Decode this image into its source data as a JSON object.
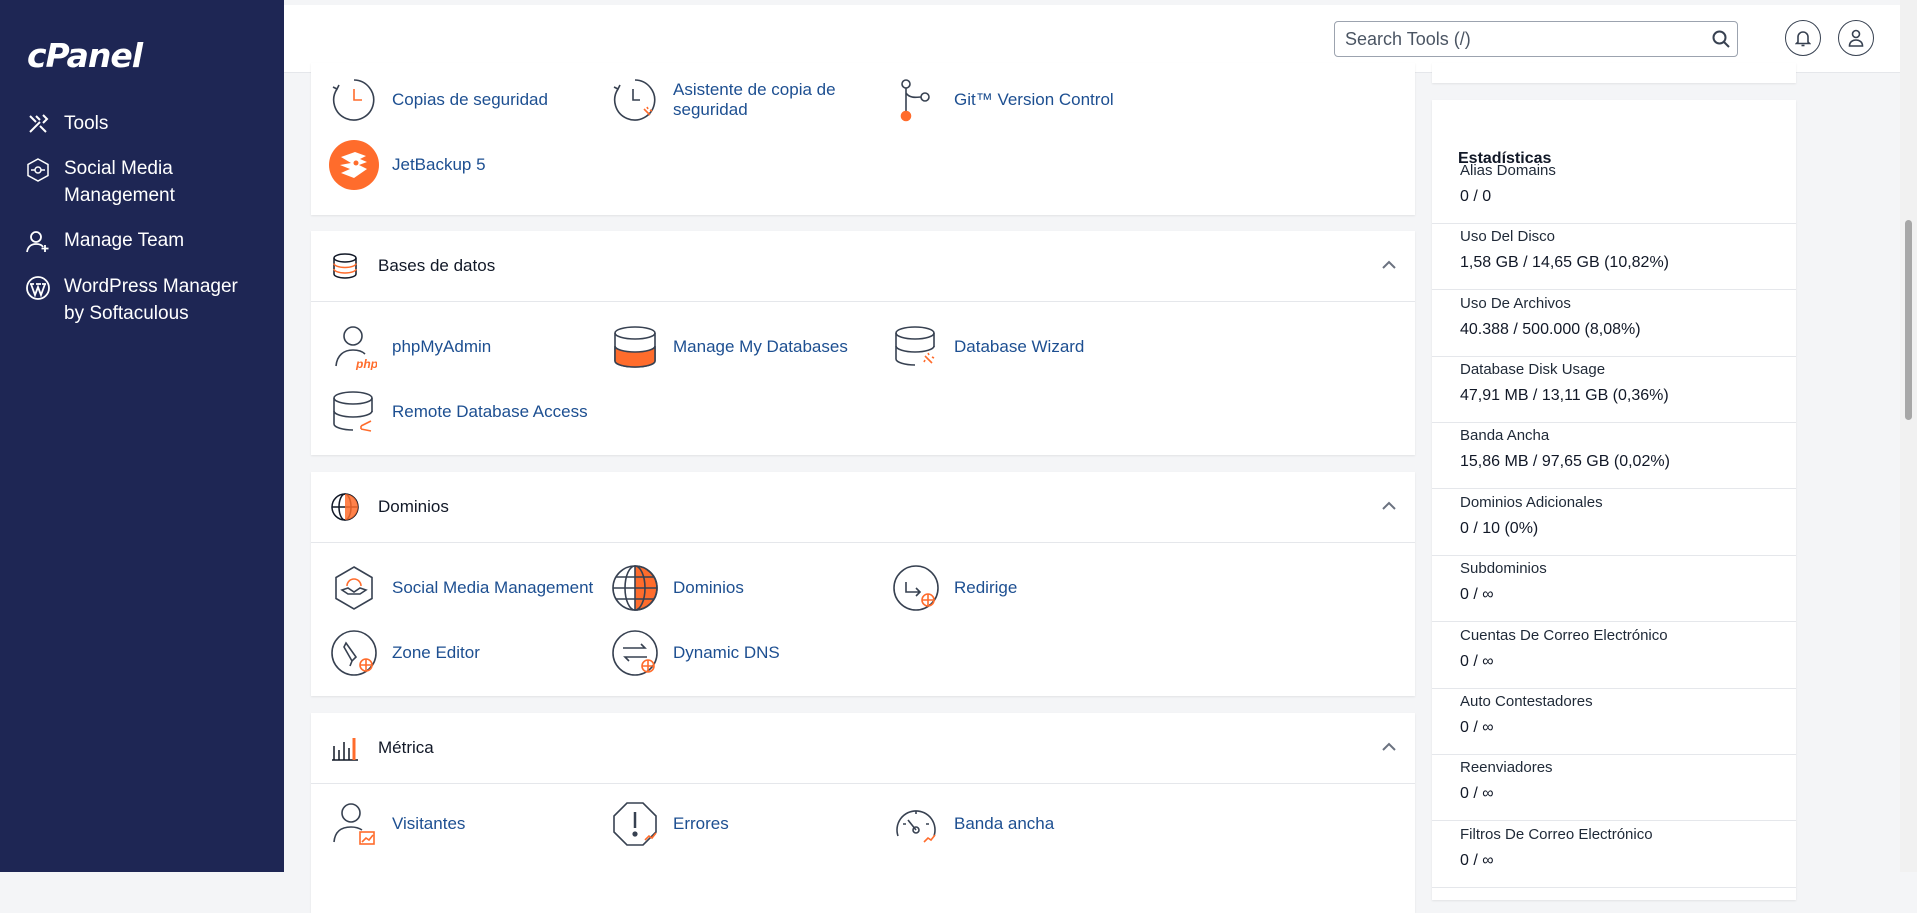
{
  "sidebar": {
    "logo": "cPanel",
    "items": [
      {
        "label_line1": "Tools",
        "label_line2": "",
        "icon": "tools-icon"
      },
      {
        "label_line1": "Social Media",
        "label_line2": "Management",
        "icon": "social-media-icon"
      },
      {
        "label_line1": "Manage Team",
        "label_line2": "",
        "icon": "manage-team-icon"
      },
      {
        "label_line1": "WordPress Manager",
        "label_line2": "by Softaculous",
        "icon": "wordpress-icon"
      }
    ]
  },
  "header": {
    "search_placeholder": "Search Tools (/)"
  },
  "sections": {
    "files": {
      "tools": [
        "Copias de seguridad",
        "Asistente de copia de",
        "seguridad",
        "Git™ Version Control",
        "JetBackup 5"
      ]
    },
    "databases": {
      "title": "Bases de datos",
      "tools": [
        "phpMyAdmin",
        "Manage My Databases",
        "Database Wizard",
        "Remote Database Access"
      ]
    },
    "domains": {
      "title": "Dominios",
      "tools": [
        "Social Media Management",
        "Dominios",
        "Redirige",
        "Zone Editor",
        "Dynamic DNS"
      ]
    },
    "metrics": {
      "title": "Métrica",
      "tools": [
        "Visitantes",
        "Errores",
        "Banda ancha"
      ]
    }
  },
  "stats": {
    "title": "Estadísticas",
    "items": [
      {
        "label": "Alias Domains",
        "value": "0 / 0"
      },
      {
        "label": "Uso Del Disco",
        "value": "1,58 GB / 14,65 GB   (10,82%)"
      },
      {
        "label": "Uso De Archivos",
        "value": "40.388 / 500.000   (8,08%)"
      },
      {
        "label": "Database Disk Usage",
        "value": "47,91 MB / 13,11 GB   (0,36%)"
      },
      {
        "label": "Banda Ancha",
        "value": "15,86 MB / 97,65 GB   (0,02%)"
      },
      {
        "label": "Dominios Adicionales",
        "value": "0 / 10   (0%)"
      },
      {
        "label": "Subdominios",
        "value": "0 / ∞"
      },
      {
        "label": "Cuentas De Correo Electrónico",
        "value": "0 / ∞"
      },
      {
        "label": "Auto Contestadores",
        "value": "0 / ∞"
      },
      {
        "label": "Reenviadores",
        "value": "0 / ∞"
      },
      {
        "label": "Filtros De Correo Electrónico",
        "value": "0 / ∞"
      }
    ]
  },
  "colors": {
    "sidebar_bg": "#1e2654",
    "link": "#1d4f91",
    "accent_orange": "#ff6c2c"
  }
}
